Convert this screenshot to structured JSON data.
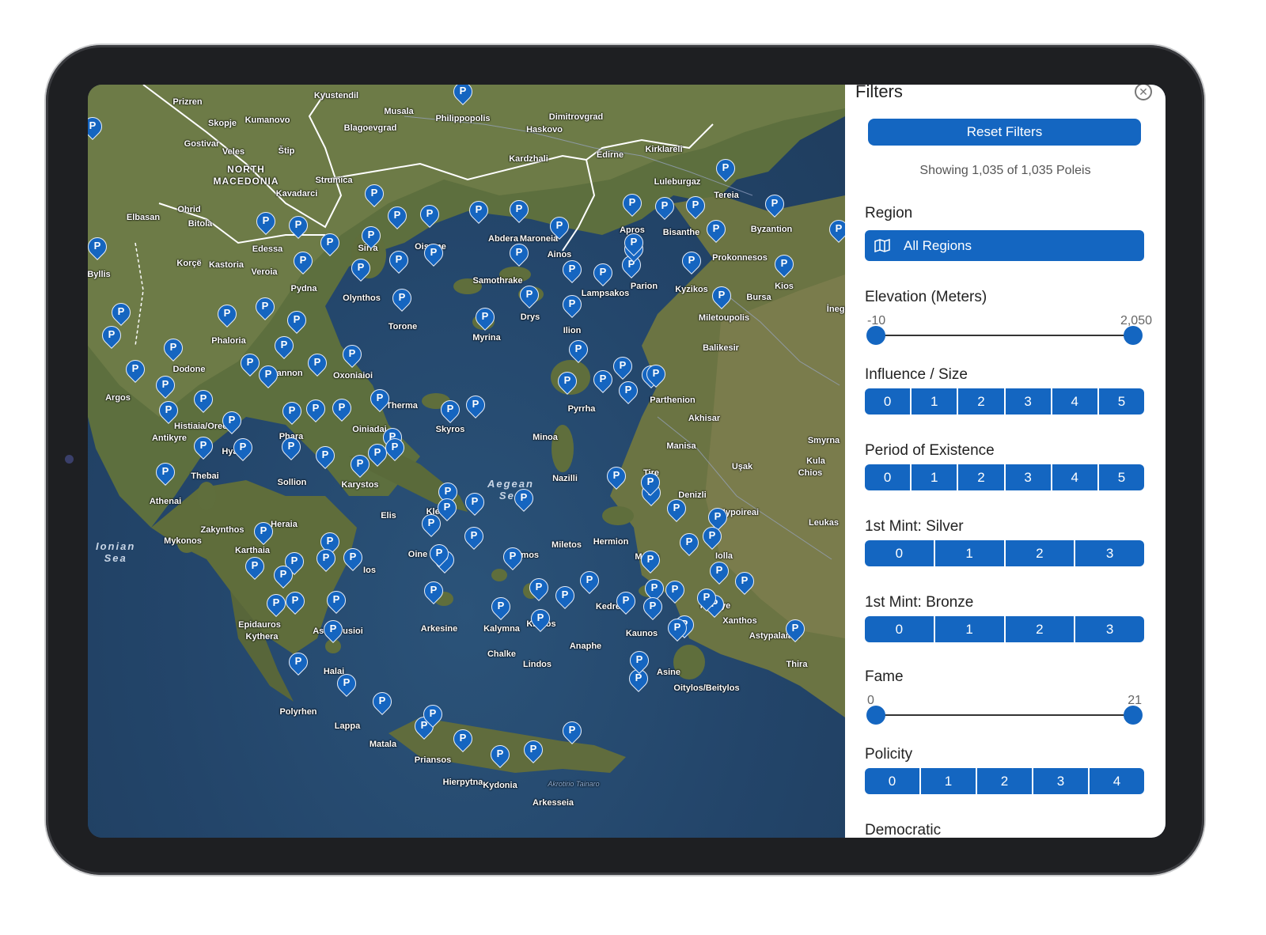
{
  "map": {
    "seas": [
      {
        "name": "Aegean",
        "name2": "Sea"
      },
      {
        "name": "Ionian",
        "name2": "Sea"
      }
    ],
    "places": [
      "Skopje",
      "Kumanovo",
      "Prizren",
      "Kyustendil",
      "Philippopolis",
      "Dimitrovgrad",
      "Haskovo",
      "Blagoevgrad",
      "Musala",
      "Gostivar",
      "Veles",
      "Štip",
      "NORTH",
      "MACEDONIA",
      "Strumica",
      "Kavadarci",
      "Ohrid",
      "Elbasan",
      "Bitola",
      "Kardzhali",
      "Edirne",
      "Kirklareli",
      "Luleburgaz",
      "Tereia",
      "Byzantion",
      "Bisanthe",
      "Apros",
      "Prokonnesos",
      "Korçë",
      "Kastoria",
      "Veroia",
      "Edessa",
      "Sirra",
      "Oisyme",
      "Abdera",
      "Maroneia",
      "Ainos",
      "Samothrake",
      "Lampsakos",
      "Parion",
      "Kyzikos",
      "Kios",
      "Bursa",
      "Miletoupolis",
      "İnegöl",
      "Balikesir",
      "Byllis",
      "Pydna",
      "Olynthos",
      "Torone",
      "Drys",
      "Myrina",
      "Ilion",
      "Phaloria",
      "Dodone",
      "Krannon",
      "Oxoniaioi",
      "Therma",
      "Skyros",
      "Minoa",
      "Pyrrha",
      "Parthenion",
      "Akhisar",
      "Manisa",
      "Iolla",
      "Uşak",
      "Kula",
      "Smyrna",
      "Chios",
      "Tire",
      "Nazilli",
      "Denizli",
      "Hypoireai",
      "Leukas",
      "Argos",
      "Antikyre",
      "Histiaia/Oreos",
      "Phara",
      "Oiniadai",
      "Hyaia",
      "Thebai",
      "Sollion",
      "Karystos",
      "Athenai",
      "Kleitor",
      "Elis",
      "Heraia",
      "Zakynthos",
      "Karthaia",
      "Mykonos",
      "Oine",
      "Samos",
      "Miletos",
      "Hermion",
      "Melos",
      "Ios",
      "Arkesine",
      "Kalymna",
      "Knidos",
      "Kedreai",
      "Kaunos",
      "Fethiye",
      "Xanthos",
      "Astypalaia/2",
      "Thira",
      "Anaphe",
      "Chalke",
      "Lindos",
      "Asine",
      "Oitylos/Beitylos",
      "Epidauros",
      "Kythera",
      "Astraiousioi",
      "Halai",
      "Polyrhen",
      "Lappa",
      "Matala",
      "Priansos",
      "Hierpytna",
      "Kydonia",
      "Arkesseia",
      "Akrotirio Tainaro"
    ]
  },
  "panel": {
    "title": "Filters",
    "reset_label": "Reset Filters",
    "showing_text": "Showing 1,035 of 1,035 Poleis",
    "region": {
      "label": "Region",
      "value": "All Regions"
    },
    "elevation": {
      "label": "Elevation (Meters)",
      "min": "-10",
      "max": "2,050"
    },
    "influence": {
      "label": "Influence / Size",
      "options": [
        "0",
        "1",
        "2",
        "3",
        "4",
        "5"
      ]
    },
    "period": {
      "label": "Period of Existence",
      "options": [
        "0",
        "1",
        "2",
        "3",
        "4",
        "5"
      ]
    },
    "mint_silver": {
      "label": "1st Mint: Silver",
      "options": [
        "0",
        "1",
        "2",
        "3"
      ]
    },
    "mint_bronze": {
      "label": "1st Mint: Bronze",
      "options": [
        "0",
        "1",
        "2",
        "3"
      ]
    },
    "fame": {
      "label": "Fame",
      "min": "0",
      "max": "21"
    },
    "policity": {
      "label": "Policity",
      "options": [
        "0",
        "1",
        "2",
        "3",
        "4"
      ]
    },
    "democratic": {
      "label": "Democratic"
    }
  },
  "colors": {
    "accent": "#1466c1",
    "marker": "#1565c0"
  }
}
